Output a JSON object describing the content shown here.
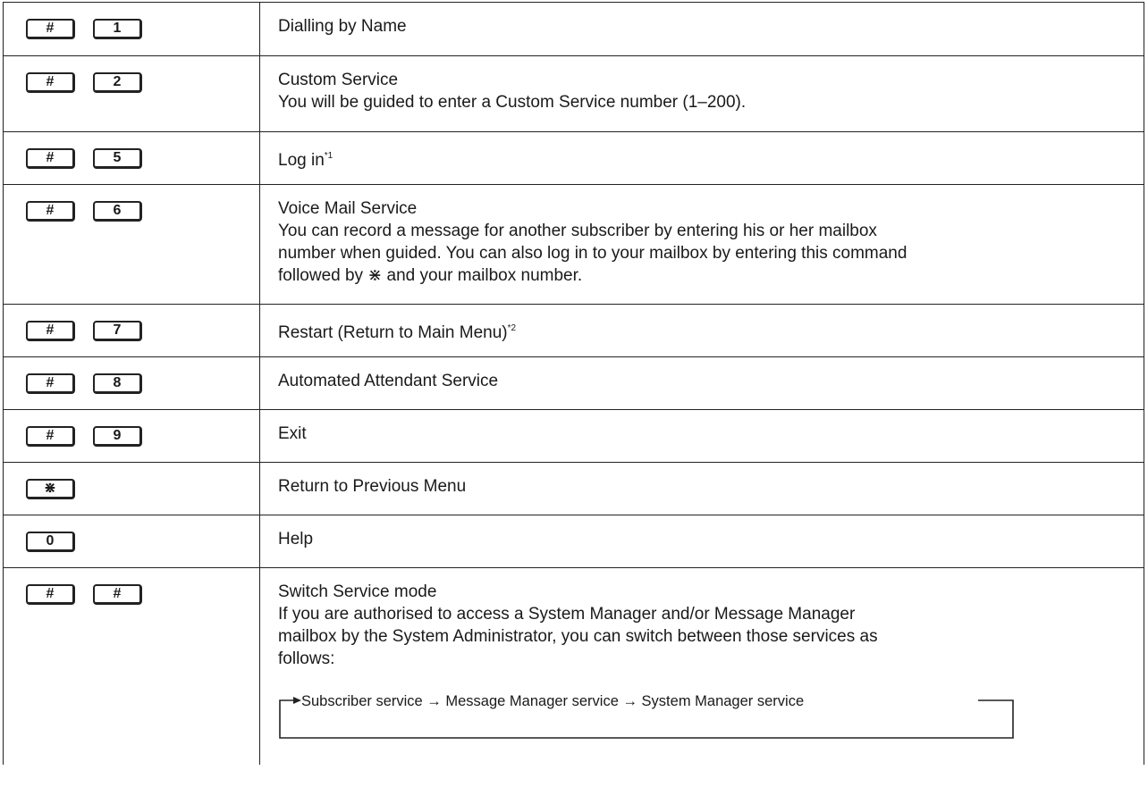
{
  "rows": [
    {
      "keys": [
        "#",
        "1"
      ],
      "title": "Dialling by Name"
    },
    {
      "keys": [
        "#",
        "2"
      ],
      "title": "Custom Service",
      "detail": "You will be guided to enter a Custom Service number (1–200)."
    },
    {
      "keys": [
        "#",
        "5"
      ],
      "title": "Log in",
      "note": "*1"
    },
    {
      "keys": [
        "#",
        "6"
      ],
      "title": "Voice Mail Service",
      "detail_lines": [
        "You can record a message for another subscriber by entering his or her mailbox",
        "number when guided. You can also log in to your mailbox by entering this command",
        "followed by ⋇ and your mailbox number."
      ]
    },
    {
      "keys": [
        "#",
        "7"
      ],
      "title": "Restart (Return to Main Menu)",
      "note": "*2"
    },
    {
      "keys": [
        "#",
        "8"
      ],
      "title": "Automated Attendant Service"
    },
    {
      "keys": [
        "#",
        "9"
      ],
      "title": "Exit"
    },
    {
      "keys": [
        "⋇"
      ],
      "title": "Return to Previous Menu"
    },
    {
      "keys": [
        "0"
      ],
      "title": "Help"
    },
    {
      "keys": [
        "#",
        "#"
      ],
      "title": "Switch Service mode",
      "detail_lines": [
        "If you are authorised to access a System Manager and/or Message Manager",
        "mailbox by the System Administrator, you can switch between those services as",
        "follows:"
      ],
      "flow": "Subscriber service → Message Manager service → System Manager service"
    }
  ]
}
